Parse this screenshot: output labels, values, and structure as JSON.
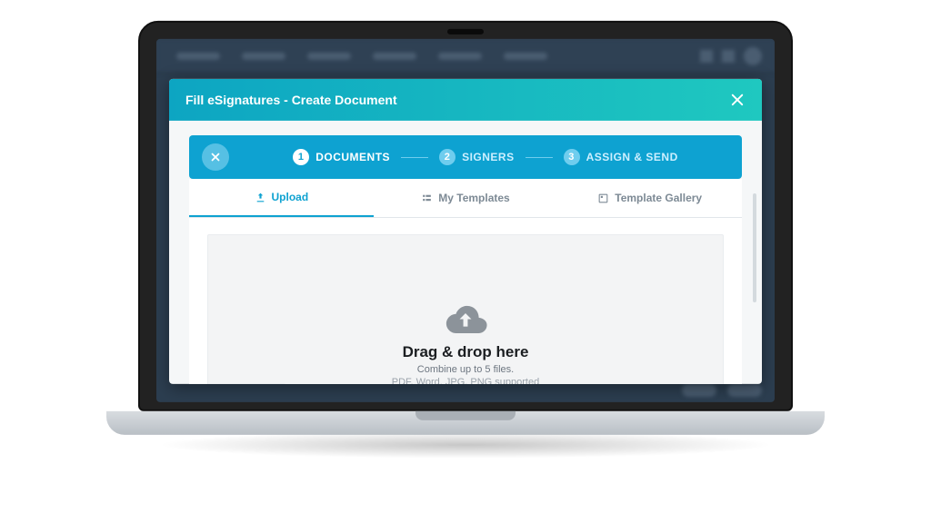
{
  "modal": {
    "title": "Fill eSignatures - Create Document",
    "close_icon": "close"
  },
  "stepper": {
    "steps": [
      {
        "num": "1",
        "label": "DOCUMENTS",
        "active": true
      },
      {
        "num": "2",
        "label": "SIGNERS",
        "active": false
      },
      {
        "num": "3",
        "label": "ASSIGN & SEND",
        "active": false
      }
    ]
  },
  "tabs": {
    "upload": "Upload",
    "my_templates": "My Templates",
    "template_gallery": "Template Gallery"
  },
  "dropzone": {
    "headline": "Drag & drop here",
    "subline": "Combine up to 5 files.",
    "formats": "PDF, Word, JPG, PNG supported"
  }
}
